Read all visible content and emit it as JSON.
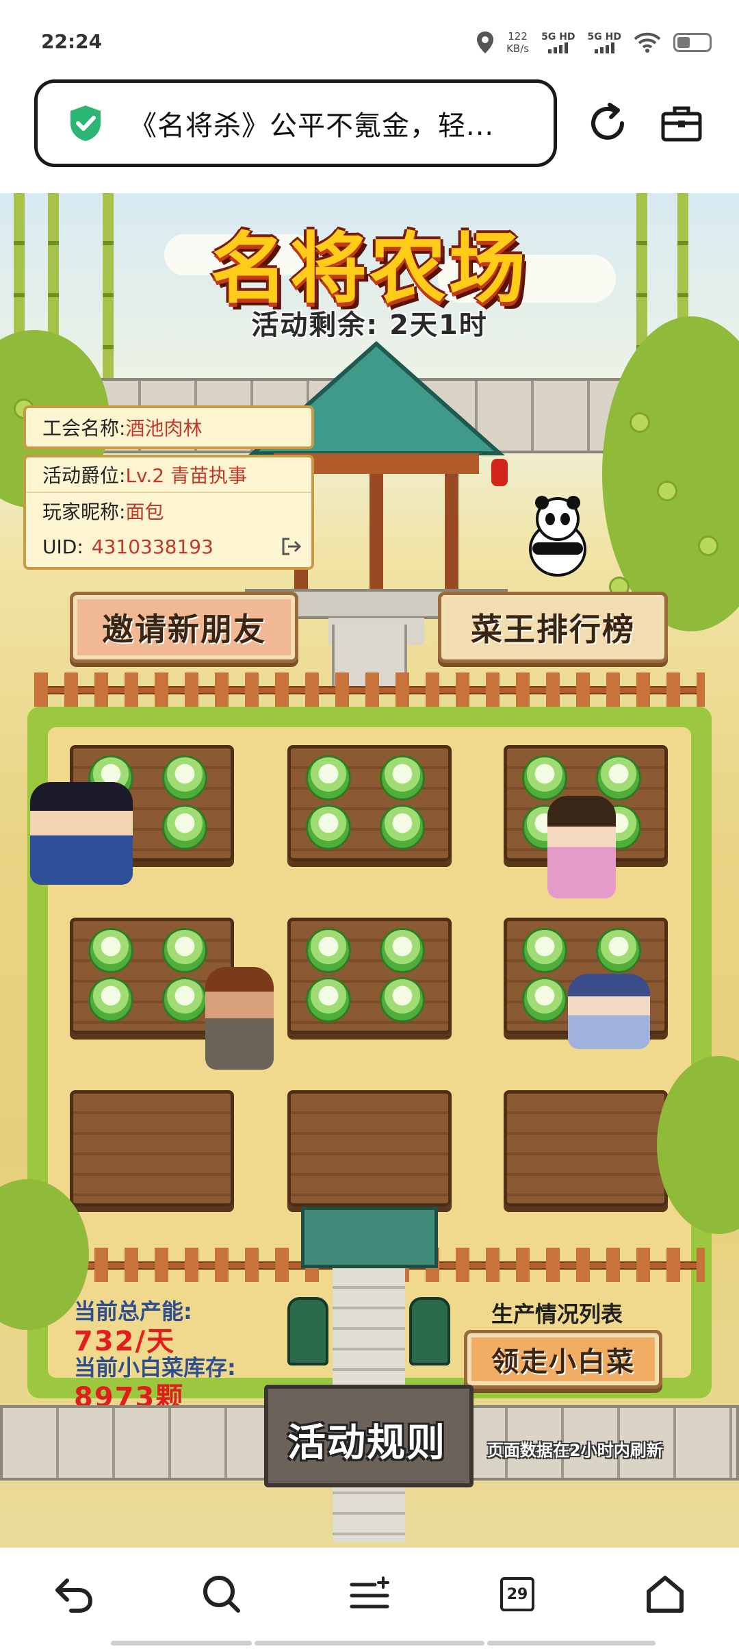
{
  "status_bar": {
    "time": "22:24",
    "net_speed_value": "122",
    "net_speed_unit": "KB/s",
    "signal1": "5G HD",
    "signal2": "5G HD"
  },
  "browser": {
    "page_title": "《名将杀》公平不氪金，轻...",
    "icons": [
      "shield-check-icon",
      "reload-icon",
      "toolbox-icon"
    ]
  },
  "game": {
    "title": "名将农场",
    "countdown": "活动剩余: 2天1时",
    "guild_label": "工会名称:",
    "guild_name": "酒池肉林",
    "rank_label": "活动爵位:",
    "rank_value": "Lv.2 青苗执事",
    "nickname_label": "玩家昵称:",
    "nickname_value": "面包",
    "uid_label": "UID:",
    "uid_value": "4310338193",
    "invite_button": "邀请新朋友",
    "leaderboard_button": "菜王排行榜",
    "total_capacity_label": "当前总产能:",
    "total_capacity_value": "732/天",
    "stock_label": "当前小白菜库存:",
    "stock_value": "8973颗",
    "production_list_link": "生产情况列表",
    "collect_button": "领走小白菜",
    "rules_button": "活动规则",
    "refresh_note": "页面数据在2小时内刷新",
    "plots": [
      {
        "cabbages": 4
      },
      {
        "cabbages": 4
      },
      {
        "cabbages": 4
      },
      {
        "cabbages": 4
      },
      {
        "cabbages": 4
      },
      {
        "cabbages": 4
      },
      {
        "cabbages": 0
      },
      {
        "cabbages": 0
      },
      {
        "cabbages": 0
      }
    ]
  },
  "bottom_nav": {
    "tab_count": "29",
    "icons": [
      "back-icon",
      "search-icon",
      "menu-icon",
      "tabs-icon",
      "home-icon"
    ]
  },
  "colors": {
    "title_yellow": "#ffcc1a",
    "value_red": "#e11d1d",
    "label_blue": "#2e4f8f",
    "shield_green": "#2bb673"
  }
}
